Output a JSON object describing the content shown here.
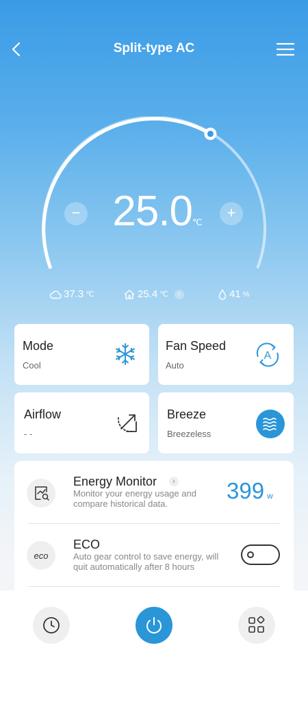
{
  "header": {
    "title": "Split-type AC"
  },
  "thermostat": {
    "temperature": "25.0",
    "unit": "℃",
    "minus": "−",
    "plus": "+",
    "setpoint_fraction": 0.72
  },
  "stats": {
    "outdoor": {
      "value": "37.3",
      "unit": "℃"
    },
    "indoor": {
      "value": "25.4",
      "unit": "℃"
    },
    "humidity": {
      "value": "41",
      "unit": "%"
    }
  },
  "cards": {
    "mode": {
      "title": "Mode",
      "value": "Cool"
    },
    "fan_speed": {
      "title": "Fan Speed",
      "value": "Auto"
    },
    "airflow": {
      "title": "Airflow",
      "value": "- -"
    },
    "breeze": {
      "title": "Breeze",
      "value": "Breezeless"
    }
  },
  "energy_monitor": {
    "title": "Energy Monitor",
    "description_line1": "Monitor your energy usage and",
    "description_line2": "compare historical data.",
    "value": "399",
    "unit": "w"
  },
  "eco": {
    "title": "ECO",
    "description_line1": "Auto gear control to save energy, will",
    "description_line2": "quit automatically after 8 hours",
    "enabled": false
  },
  "colors": {
    "accent": "#2a96d8",
    "background_top": "#3a9be6"
  }
}
